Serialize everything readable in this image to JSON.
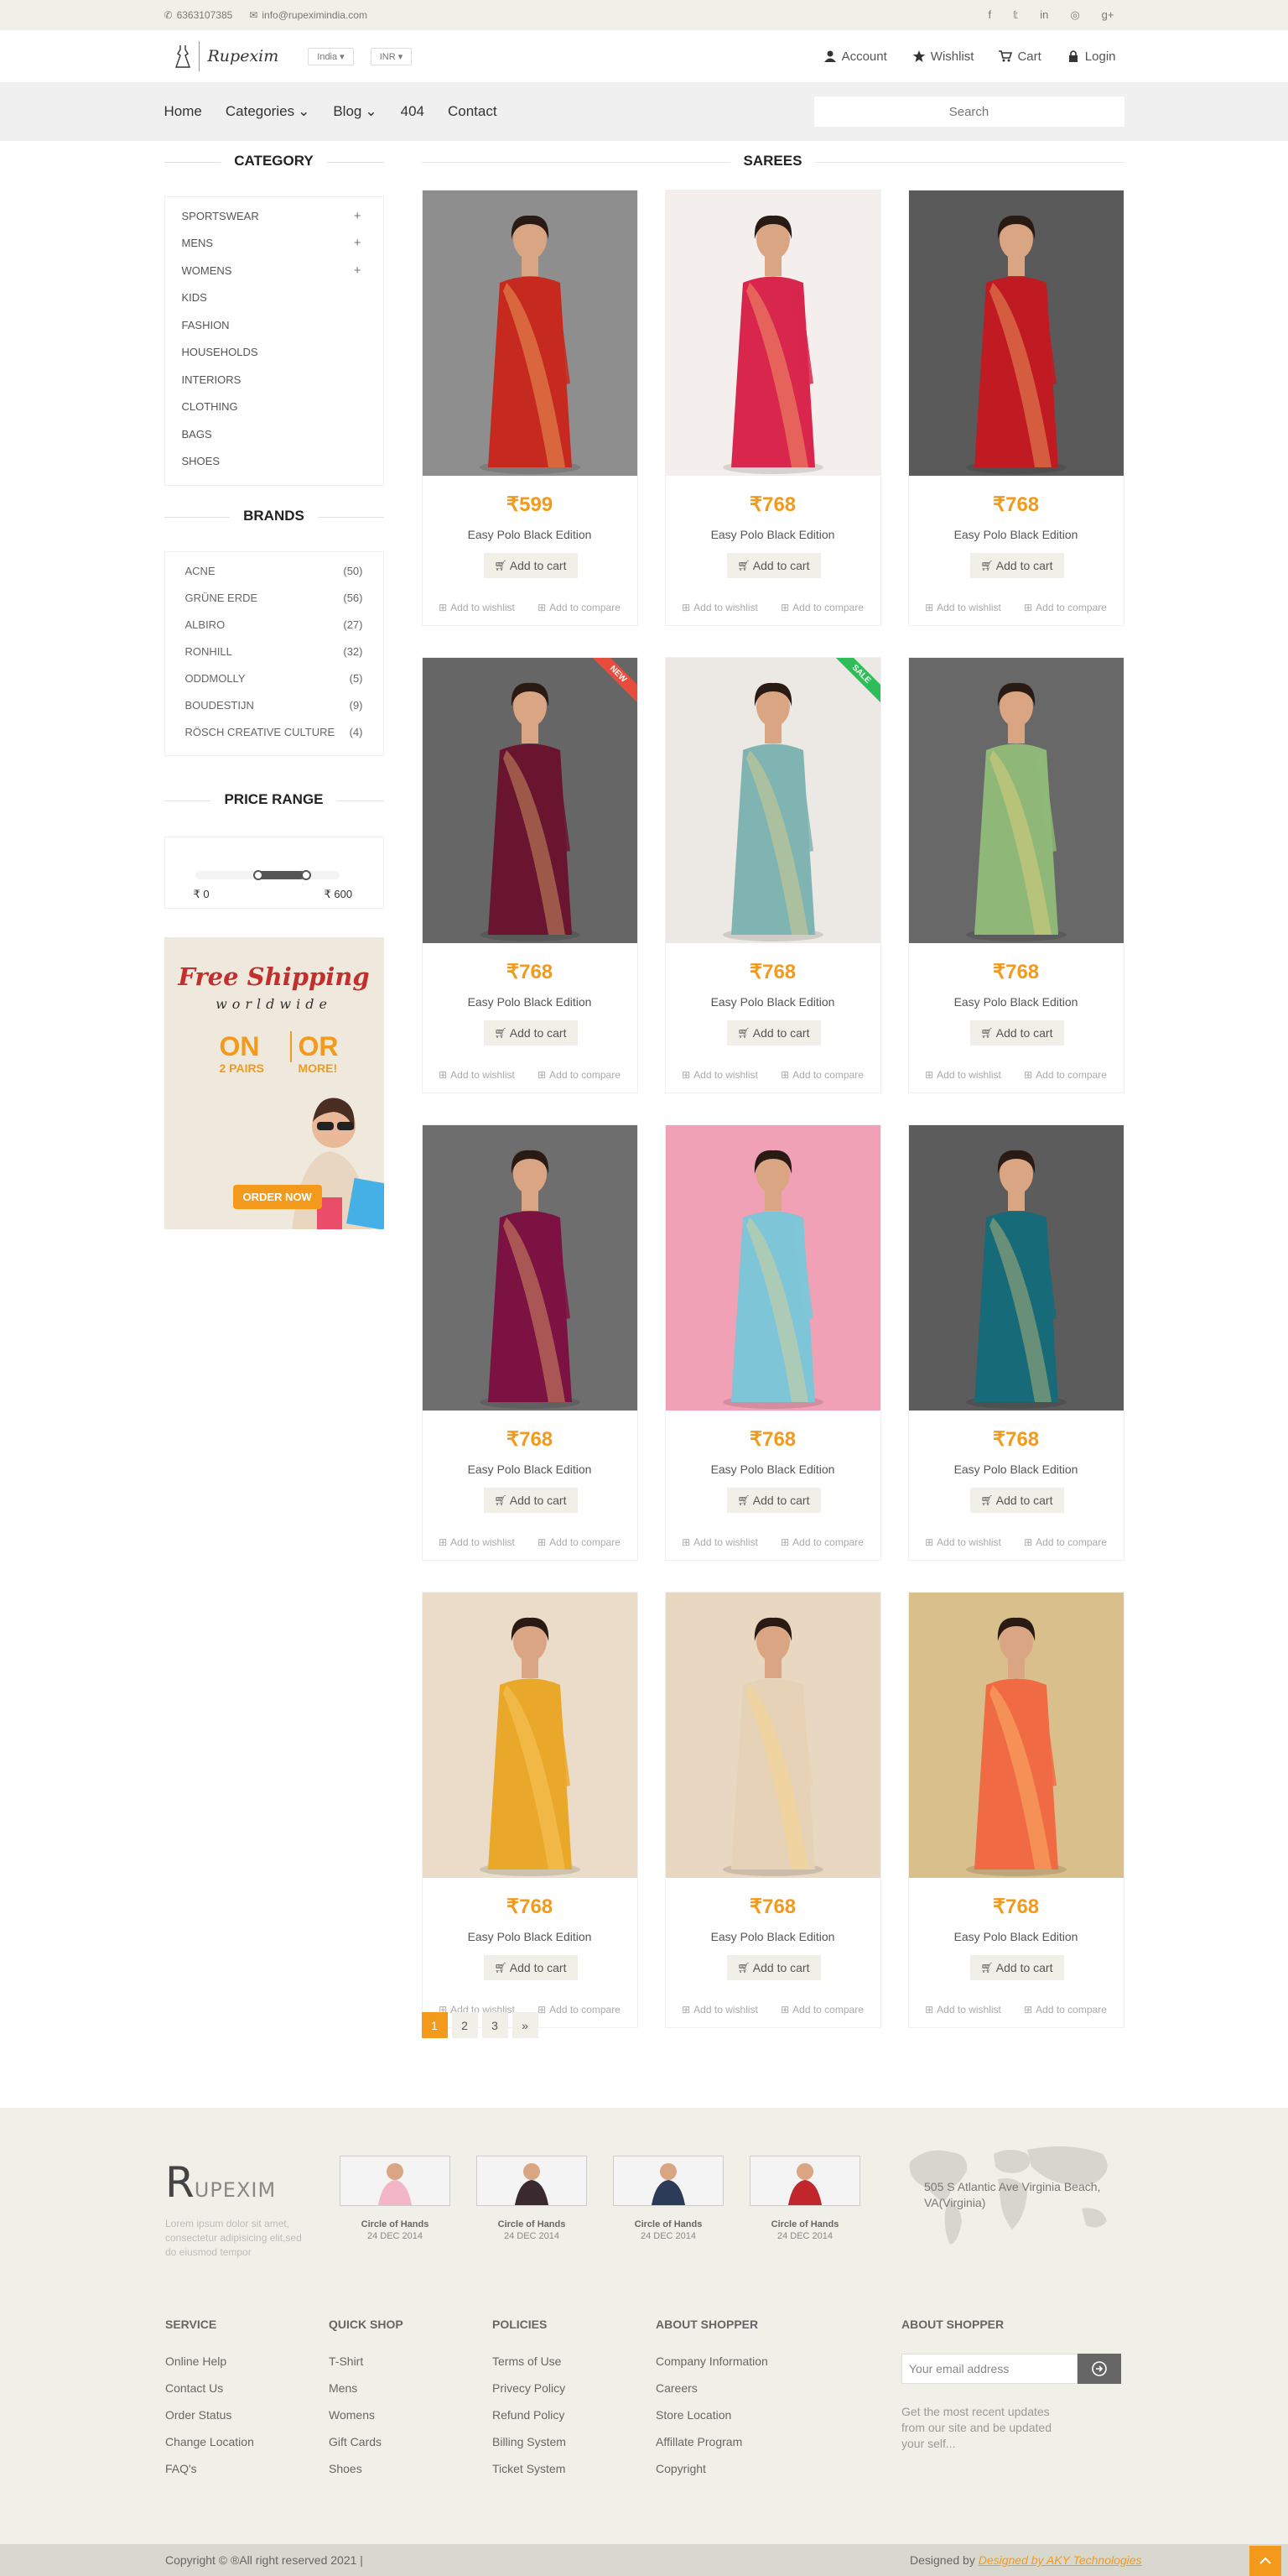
{
  "topbar": {
    "phone": "6363107385",
    "email": "info@rupeximindia.com",
    "social": [
      "facebook-icon",
      "twitter-icon",
      "linkedin-icon",
      "dribbble-icon",
      "google-plus-icon"
    ]
  },
  "header": {
    "brand": "Rupexim",
    "country": "India",
    "currency": "INR",
    "nav": [
      "Account",
      "Wishlist",
      "Cart",
      "Login"
    ]
  },
  "menu": {
    "items": [
      "Home",
      "Categories",
      "Blog",
      "404",
      "Contact"
    ],
    "search_placeholder": "Search"
  },
  "sidebar": {
    "category_title": "CATEGORY",
    "categories": [
      "SPORTSWEAR",
      "MENS",
      "WOMENS",
      "KIDS",
      "FASHION",
      "HOUSEHOLDS",
      "INTERIORS",
      "CLOTHING",
      "BAGS",
      "SHOES"
    ],
    "brands_title": "BRANDS",
    "brands": [
      {
        "name": "ACNE",
        "count": "(50)"
      },
      {
        "name": "GRÜNE ERDE",
        "count": "(56)"
      },
      {
        "name": "ALBIRO",
        "count": "(27)"
      },
      {
        "name": "RONHILL",
        "count": "(32)"
      },
      {
        "name": "ODDMOLLY",
        "count": "(5)"
      },
      {
        "name": "BOUDESTIJN",
        "count": "(9)"
      },
      {
        "name": "RÖSCH CREATIVE CULTURE",
        "count": "(4)"
      }
    ],
    "price_title": "PRICE RANGE",
    "price_min": "₹ 0",
    "price_max": "₹ 600",
    "ad": {
      "line1": "Free Shipping",
      "line2": "worldwide",
      "on": "ON",
      "on_sub": "2 PAIRS",
      "or": "OR",
      "or_sub": "MORE!",
      "cta": "ORDER NOW"
    }
  },
  "section_title": "SAREES",
  "products": [
    {
      "price": "₹599",
      "name": "Easy Polo Black Edition",
      "bg": "#8e8e8e",
      "saree": "#c62a1e",
      "ribbon": ""
    },
    {
      "price": "₹768",
      "name": "Easy Polo Black Edition",
      "bg": "#f4efec",
      "saree": "#d8264c",
      "ribbon": ""
    },
    {
      "price": "₹768",
      "name": "Easy Polo Black Edition",
      "bg": "#5a5a5a",
      "saree": "#c01b22",
      "ribbon": ""
    },
    {
      "price": "₹768",
      "name": "Easy Polo Black Edition",
      "bg": "#666666",
      "saree": "#6a1530",
      "ribbon": "NEW"
    },
    {
      "price": "₹768",
      "name": "Easy Polo Black Edition",
      "bg": "#ece9e4",
      "saree": "#7fb4b2",
      "ribbon": "SALE"
    },
    {
      "price": "₹768",
      "name": "Easy Polo Black Edition",
      "bg": "#686868",
      "saree": "#8fb878",
      "ribbon": ""
    },
    {
      "price": "₹768",
      "name": "Easy Polo Black Edition",
      "bg": "#6e6e6e",
      "saree": "#7c1242",
      "ribbon": ""
    },
    {
      "price": "₹768",
      "name": "Easy Polo Black Edition",
      "bg": "#f0a1b6",
      "saree": "#7fc5d8",
      "ribbon": ""
    },
    {
      "price": "₹768",
      "name": "Easy Polo Black Edition",
      "bg": "#5c5c5c",
      "saree": "#176a78",
      "ribbon": ""
    },
    {
      "price": "₹768",
      "name": "Easy Polo Black Edition",
      "bg": "#eadcc8",
      "saree": "#eaa82a",
      "ribbon": ""
    },
    {
      "price": "₹768",
      "name": "Easy Polo Black Edition",
      "bg": "#e8d8c2",
      "saree": "#e6d2b6",
      "ribbon": ""
    },
    {
      "price": "₹768",
      "name": "Easy Polo Black Edition",
      "bg": "#d8bf8c",
      "saree": "#f06a44",
      "ribbon": ""
    }
  ],
  "card_labels": {
    "cart": "Add to cart",
    "wishlist": "Add to wishlist",
    "compare": "Add to compare"
  },
  "pagination": [
    "1",
    "2",
    "3",
    "»"
  ],
  "footer": {
    "logo_initial": "R",
    "logo_rest": "UPEXIM",
    "logo_text": "Lorem ipsum dolor sit amet, consectetur adipisicing elit,sed do eiusmod tempor",
    "videos": [
      {
        "title": "Circle of Hands",
        "date": "24 DEC 2014",
        "color": "#f3b6c8"
      },
      {
        "title": "Circle of Hands",
        "date": "24 DEC 2014",
        "color": "#3a2a30"
      },
      {
        "title": "Circle of Hands",
        "date": "24 DEC 2014",
        "color": "#2c3c58"
      },
      {
        "title": "Circle of Hands",
        "date": "24 DEC 2014",
        "color": "#c0262c"
      }
    ],
    "address": "505 S Atlantic Ave Virginia Beach, VA(Virginia)",
    "columns": [
      {
        "title": "SERVICE",
        "links": [
          "Online Help",
          "Contact Us",
          "Order Status",
          "Change Location",
          "FAQ's"
        ]
      },
      {
        "title": "QUICK SHOP",
        "links": [
          "T-Shirt",
          "Mens",
          "Womens",
          "Gift Cards",
          "Shoes"
        ]
      },
      {
        "title": "POLICIES",
        "links": [
          "Terms of Use",
          "Privecy Policy",
          "Refund Policy",
          "Billing System",
          "Ticket System"
        ]
      },
      {
        "title": "ABOUT SHOPPER",
        "links": [
          "Company Information",
          "Careers",
          "Store Location",
          "Affillate Program",
          "Copyright"
        ]
      }
    ],
    "subscribe_title": "ABOUT SHOPPER",
    "email_placeholder": "Your email address",
    "subscribe_text": "Get the most recent updates from our site and be updated your self...",
    "copyright": "Copyright © ®All right reserved 2021 |",
    "designed_prefix": "Designed by ",
    "designed_by": "Designed by AKY Technologies"
  },
  "colors": {
    "accent": "#f39a1c",
    "topbar": "#f0f0e9",
    "navbar": "#f0f0f0"
  }
}
